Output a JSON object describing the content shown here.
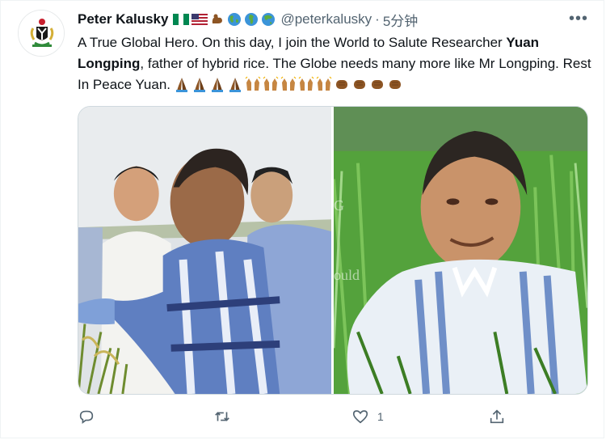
{
  "tweet": {
    "author_name": "Peter Kalusky",
    "handle": "@peterkalusky",
    "separator": "·",
    "time": "5分钟",
    "more_label": "•••",
    "text_part1": "A True Global Hero. On this day, I join the World to Salute Researcher ",
    "text_bold": "Yuan Longping",
    "text_part2": ", father of hybrid rice. The Globe needs many more like Mr Longping. Rest In Peace Yuan.",
    "name_badges": [
      "nigeria-flag-icon",
      "us-flag-icon",
      "flexed-arm-icon",
      "globe-americas-icon",
      "globe-europe-africa-icon",
      "globe-asia-icon"
    ],
    "emojis": [
      "folded-hands-icon",
      "folded-hands-icon",
      "folded-hands-icon",
      "folded-hands-icon",
      "raised-hands-icon",
      "raised-hands-icon",
      "raised-hands-icon",
      "raised-hands-icon",
      "raised-hands-icon",
      "raised-fist-icon",
      "raised-fist-icon",
      "raised-fist-icon",
      "raised-fist-icon"
    ],
    "photo_right_watermark_top": "G",
    "photo_right_watermark": "ould"
  },
  "actions": {
    "reply_icon": "reply-icon",
    "retweet_icon": "retweet-icon",
    "like_icon": "heart-icon",
    "like_count": "1",
    "share_icon": "share-icon"
  },
  "colors": {
    "text_primary": "#0f1419",
    "text_secondary": "#536471",
    "border": "#cfd9de",
    "skin_emoji": "#8d5524"
  }
}
